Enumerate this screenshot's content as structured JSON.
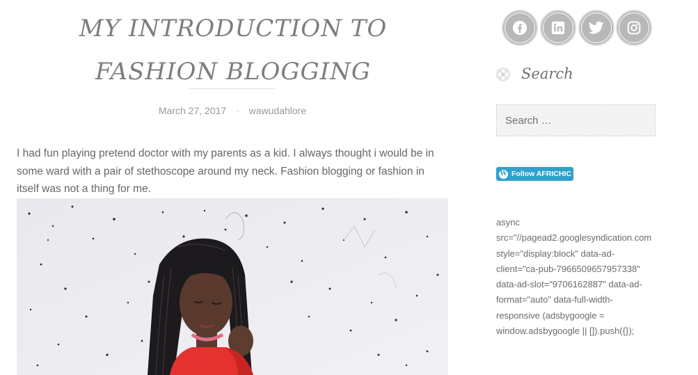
{
  "post": {
    "title_line1": "My Introduction to",
    "title_line2": "Fashion Blogging",
    "date": "March 27, 2017",
    "author": "wawudahlore",
    "paragraph": "I had fun playing pretend doctor with my parents as a kid. I always thought i would be in some ward with a pair of stethoscope around my neck. Fashion blogging or fashion in itself was not a thing for me."
  },
  "sidebar": {
    "social_icons": [
      "facebook-icon",
      "linkedin-icon",
      "twitter-icon",
      "instagram-icon"
    ],
    "search_title": "Search",
    "search_placeholder": "Search …",
    "follow_label": "Follow AFRICHIC",
    "ad_code": "async\nsrc=\"//pagead2.googlesyndication.com\nstyle=\"display:block\" data-ad-\nclient=\"ca-pub-7966509657957338\"\ndata-ad-slot=\"9706162887\" data-ad-\nformat=\"auto\" data-full-width-\nresponsive (adsbygoogle =\nwindow.adsbygoogle || []).push({});"
  },
  "colors": {
    "accent_follow": "#2ea2cc",
    "social_circle": "#b8b8b8",
    "text": "#666666"
  }
}
